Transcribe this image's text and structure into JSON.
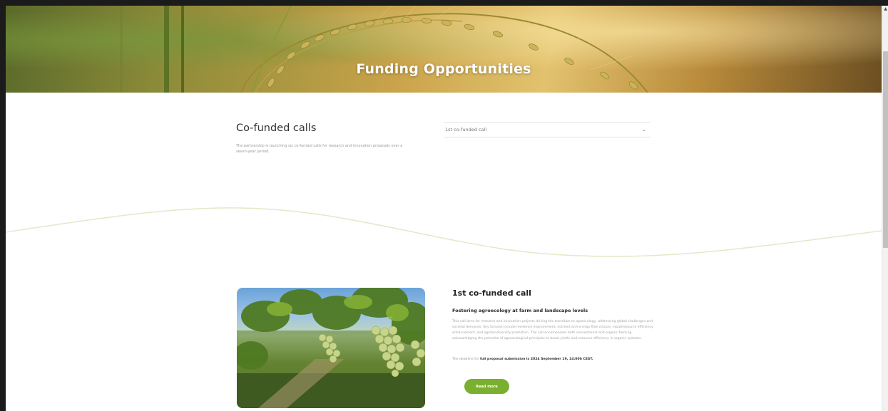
{
  "hero": {
    "title": "Funding Opportunities"
  },
  "cofunded": {
    "title": "Co-funded calls",
    "description": "The partnership is launching six co-funded calls for research and innovation proposals over a seven-year period."
  },
  "call_select": {
    "selected": "1st co-funded call",
    "options": [
      "1st co-funded call"
    ]
  },
  "call_card": {
    "title": "1st co-funded call",
    "subtitle": "Fostering agroecology at farm and landscape levels",
    "body": "This call aims for research and innovation projects driving the transition to agroecology, addressing global challenges and societal demands. Key focuses include resilience improvement, nutrient and energy flow closure, input/resource efficiency enhancement, and agrobiodiversity promotion. The call encompasses both conventional and organic farming, acknowledging the potential of agroecological principles to boost yields and resource efficiency in organic systems.",
    "deadline_prefix": "The deadline for ",
    "deadline_bold": "full proposal submission is 2024 September 19, 14:00h CEST.",
    "button_label": "Read more"
  },
  "colors": {
    "accent_green": "#7aaf2f",
    "wave_line": "#e3e8c8"
  },
  "icons": {
    "select": "chevron-down-icon",
    "scroll_up": "arrow-up-icon"
  }
}
